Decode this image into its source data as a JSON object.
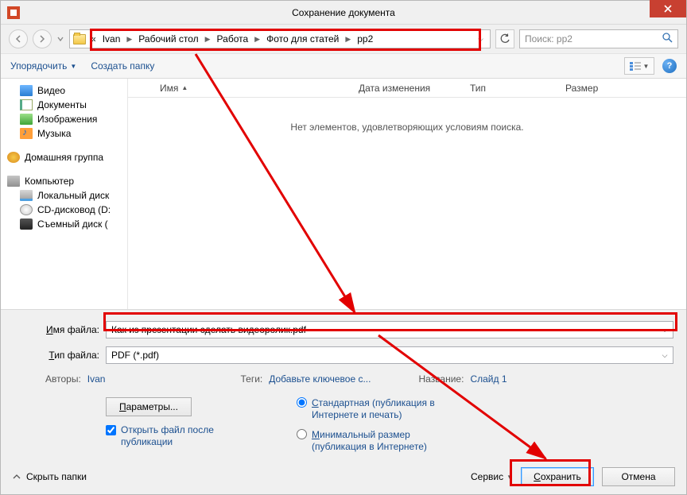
{
  "title": "Сохранение документа",
  "breadcrumbs": {
    "prefix": "«",
    "p0": "Ivan",
    "p1": "Рабочий стол",
    "p2": "Работа",
    "p3": "Фото для статей",
    "p4": "pp2"
  },
  "search": {
    "placeholder": "Поиск: pp2"
  },
  "toolbar": {
    "organize": "Упорядочить",
    "newfolder": "Создать папку"
  },
  "sidebar": {
    "video": "Видео",
    "docs": "Документы",
    "images": "Изображения",
    "music": "Музыка",
    "homegroup": "Домашняя группа",
    "computer": "Компьютер",
    "localdisk": "Локальный диск",
    "cddrive": "CD-дисковод (D:",
    "removable": "Съемный диск ("
  },
  "columns": {
    "name": "Имя",
    "date": "Дата изменения",
    "type": "Тип",
    "size": "Размер"
  },
  "empty": "Нет элементов, удовлетворяющих условиям поиска.",
  "filename": {
    "label": "Имя файла:",
    "label_u": "И",
    "value": "Как из презентации сделать видеоролик.pdf"
  },
  "filetype": {
    "label": "Тип файла:",
    "label_u": "Т",
    "value": "PDF (*.pdf)"
  },
  "meta": {
    "authors_l": "Авторы:",
    "authors_v": "Ivan",
    "tags_l": "Теги:",
    "tags_v": "Добавьте ключевое с...",
    "title_l": "Название:",
    "title_v": "Слайд 1"
  },
  "params_btn": "Параметры...",
  "params_u": "П",
  "open_after": "Открыть файл после публикации",
  "opt_standard": "Стандартная (публикация в Интернете и печать)",
  "opt_standard_u": "С",
  "opt_min": "Минимальный размер (публикация в Интернете)",
  "opt_min_u": "М",
  "hide_folders": "Скрыть папки",
  "service": "Сервис",
  "save": "Сохранить",
  "save_u": "С",
  "cancel": "Отмена"
}
